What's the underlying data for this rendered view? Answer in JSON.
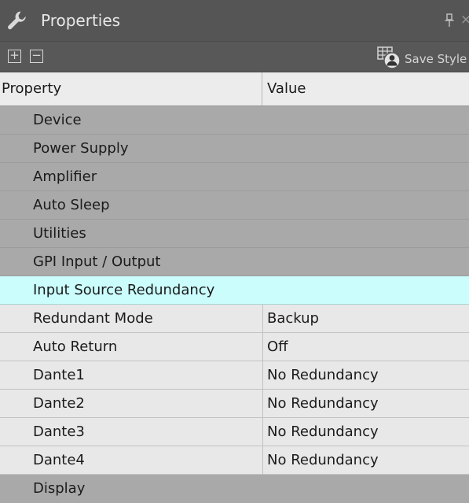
{
  "panel": {
    "title": "Properties",
    "close_glyph": "×"
  },
  "toolbar": {
    "expand_glyph": "+",
    "collapse_glyph": "−",
    "save_style_label": "Save Style",
    "save_style_icon": "grid-user-icon"
  },
  "grid": {
    "header_property": "Property",
    "header_value": "Value",
    "rows": [
      {
        "label": "Device",
        "value": "",
        "kind": "category"
      },
      {
        "label": "Power Supply",
        "value": "",
        "kind": "category"
      },
      {
        "label": "Amplifier",
        "value": "",
        "kind": "category"
      },
      {
        "label": "Auto Sleep",
        "value": "",
        "kind": "category"
      },
      {
        "label": "Utilities",
        "value": "",
        "kind": "category"
      },
      {
        "label": "GPI Input / Output",
        "value": "",
        "kind": "category"
      },
      {
        "label": "Input Source Redundancy",
        "value": "",
        "kind": "category",
        "selected": true
      },
      {
        "label": "Redundant Mode",
        "value": "Backup",
        "kind": "property"
      },
      {
        "label": "Auto Return",
        "value": "Off",
        "kind": "property"
      },
      {
        "label": "Dante1",
        "value": "No Redundancy",
        "kind": "property"
      },
      {
        "label": "Dante2",
        "value": "No Redundancy",
        "kind": "property"
      },
      {
        "label": "Dante3",
        "value": "No Redundancy",
        "kind": "property"
      },
      {
        "label": "Dante4",
        "value": "No Redundancy",
        "kind": "property"
      },
      {
        "label": "Display",
        "value": "",
        "kind": "category"
      }
    ]
  },
  "colors": {
    "titlebar": "#555555",
    "category_row": "#a9a9a9",
    "selected_row": "#cbfdfd",
    "property_row": "#e8e8e8"
  }
}
